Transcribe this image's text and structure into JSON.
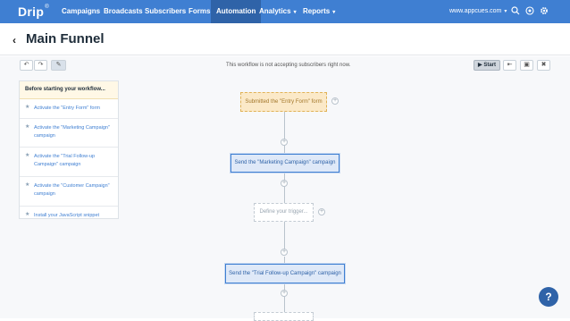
{
  "nav": {
    "logo": "Drip",
    "logo_sup": "®",
    "items": [
      "Campaigns",
      "Broadcasts",
      "Subscribers",
      "Forms",
      "Automation",
      "Analytics",
      "Reports"
    ],
    "account": "www.appcues.com"
  },
  "header": {
    "title": "Main Funnel"
  },
  "status_message": "This workflow is not accepting subscribers right now.",
  "start_label": "Start",
  "panel": {
    "heading": "Before starting your workflow...",
    "items": [
      "Activate the \"Entry Form\" form",
      "Activate the \"Marketing Campaign\" campaign",
      "Activate the \"Trial Follow-up Campaign\" campaign",
      "Activate the \"Customer Campaign\" campaign",
      "Install your JavaScript snippet"
    ]
  },
  "workflow": {
    "trigger": "Submitted the \"Entry Form\" form",
    "email1": "Send the \"Marketing Campaign\" campaign",
    "define": "Define your trigger...",
    "email2": "Send the \"Trial Follow-up Campaign\" campaign"
  },
  "help_label": "?"
}
